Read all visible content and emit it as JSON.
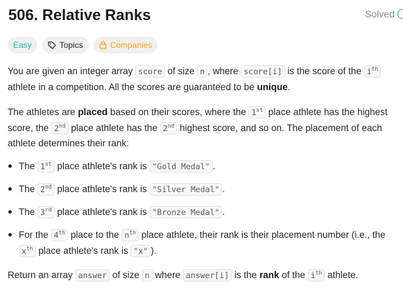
{
  "problem": {
    "title": "506. Relative Ranks",
    "status": "Solved"
  },
  "tags": {
    "difficulty": "Easy",
    "topics": "Topics",
    "companies": "Companies"
  },
  "description": {
    "p1": {
      "t1": "You are given an integer array ",
      "c1": "score",
      "t2": " of size ",
      "c2": "n",
      "t3": ", where ",
      "c3": "score[i]",
      "t4": " is the score of the ",
      "c4_base": "i",
      "c4_sup": "th",
      "t5": " athlete in a competition. All the scores are guaranteed to be ",
      "b1": "unique",
      "t6": "."
    },
    "p2": {
      "t1": "The athletes are ",
      "b1": "placed",
      "t2": " based on their scores, where the ",
      "c1_base": "1",
      "c1_sup": "st",
      "t3": " place athlete has the highest score, the ",
      "c2_base": "2",
      "c2_sup": "nd",
      "t4": " place athlete has the ",
      "c3_base": "2",
      "c3_sup": "nd",
      "t5": " highest score, and so on. The placement of each athlete determines their rank:"
    },
    "list": [
      {
        "t1": "The ",
        "c1_base": "1",
        "c1_sup": "st",
        "t2": " place athlete's rank is ",
        "c2": "\"Gold Medal\"",
        "t3": "."
      },
      {
        "t1": "The ",
        "c1_base": "2",
        "c1_sup": "nd",
        "t2": " place athlete's rank is ",
        "c2": "\"Silver Medal\"",
        "t3": "."
      },
      {
        "t1": "The ",
        "c1_base": "3",
        "c1_sup": "rd",
        "t2": " place athlete's rank is ",
        "c2": "\"Bronze Medal\"",
        "t3": "."
      },
      {
        "t1": "For the ",
        "c1_base": "4",
        "c1_sup": "th",
        "t2": " place to the ",
        "c2_base": "n",
        "c2_sup": "th",
        "t3": " place athlete, their rank is their placement number (i.e., the ",
        "c3_base": "x",
        "c3_sup": "th",
        "t4": " place athlete's rank is ",
        "c4": "\"x\"",
        "t5": ")."
      }
    ],
    "p3": {
      "t1": "Return an array ",
      "c1": "answer",
      "t2": " of size ",
      "c2": "n",
      "t3": " where ",
      "c3": "answer[i]",
      "t4": " is the ",
      "b1": "rank",
      "t5": " of the ",
      "c4_base": "i",
      "c4_sup": "th",
      "t6": " athlete."
    }
  },
  "colors": {
    "easy": "#1cb8b8",
    "companies": "#ffa116",
    "solved_check": "#2cbb5d"
  },
  "icons": {
    "topics": "tag-icon",
    "companies": "lock-icon",
    "solved": "check-circle-icon"
  }
}
